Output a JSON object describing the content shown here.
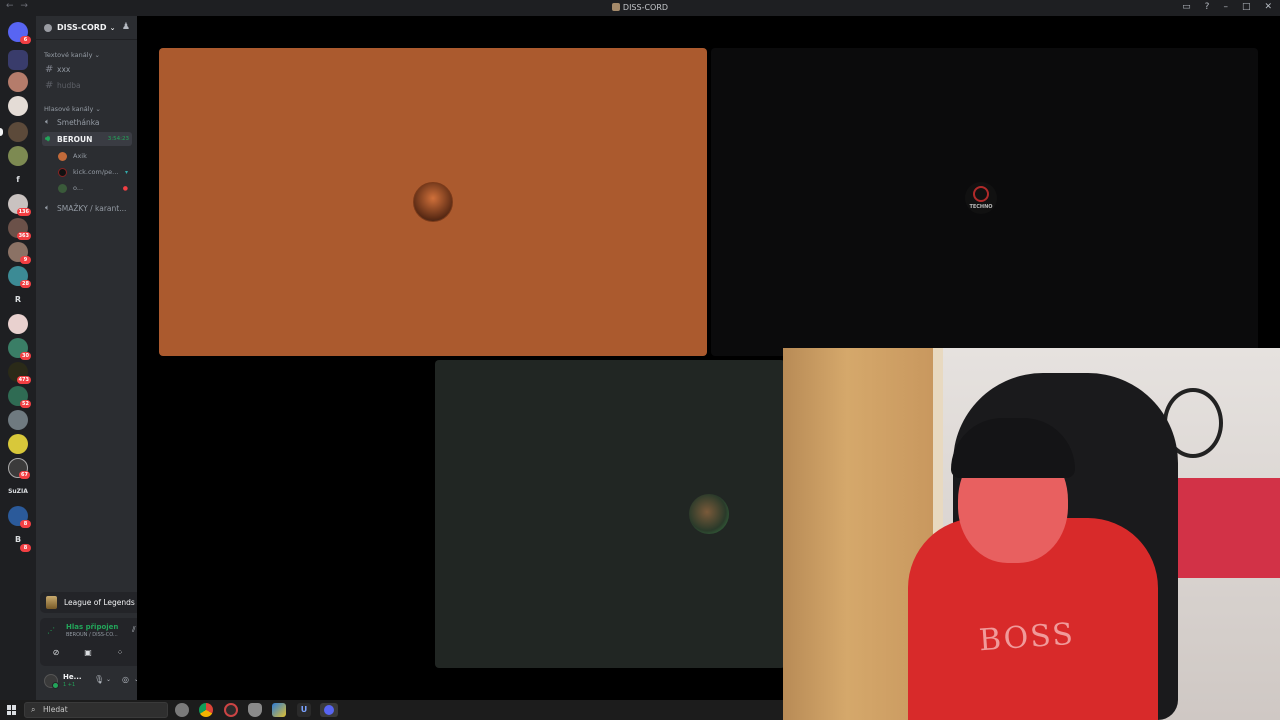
{
  "window": {
    "title": "DISS-CORD",
    "nav": "← →"
  },
  "rail": {
    "folder_letters": [
      "f",
      "R",
      "SuZIA",
      "B"
    ],
    "badges": [
      "6",
      "136",
      "363",
      "9",
      "28",
      "30",
      "473",
      "52",
      "67",
      "8",
      "8"
    ]
  },
  "server": {
    "name": "DISS-CORD",
    "text_category": "Textové kanály",
    "voice_category": "Hlasové kanály",
    "text_channels": [
      "xxx",
      "hudba"
    ],
    "voice_channels": [
      {
        "name": "Smethánka"
      },
      {
        "name": "BEROUN",
        "timer": "3:54:23",
        "active": true
      },
      {
        "name": "SMAŽKY / karant..."
      }
    ],
    "members": [
      "Axik",
      "kick.com/pe...",
      "o..."
    ]
  },
  "activity": {
    "game": "League of Legends"
  },
  "voice": {
    "status": "Hlas připojen",
    "channel_path": "BEROUN / DISS-CO..."
  },
  "user": {
    "name": "He...",
    "status": "1 +1"
  },
  "tiles": [
    {
      "bg": "#ab5a2e"
    },
    {
      "bg": "#0b0b0c",
      "logo_text": "TECHNO"
    },
    {
      "bg": "#212623"
    }
  ],
  "webcam": {
    "shirt_text": "BOSS"
  },
  "taskbar": {
    "search_placeholder": "Hledat"
  },
  "colors": {
    "voice_green": "#23a55a",
    "notification_red": "#f23f43",
    "sidebar_bg": "#2b2d31",
    "rail_bg": "#1e1f22"
  }
}
